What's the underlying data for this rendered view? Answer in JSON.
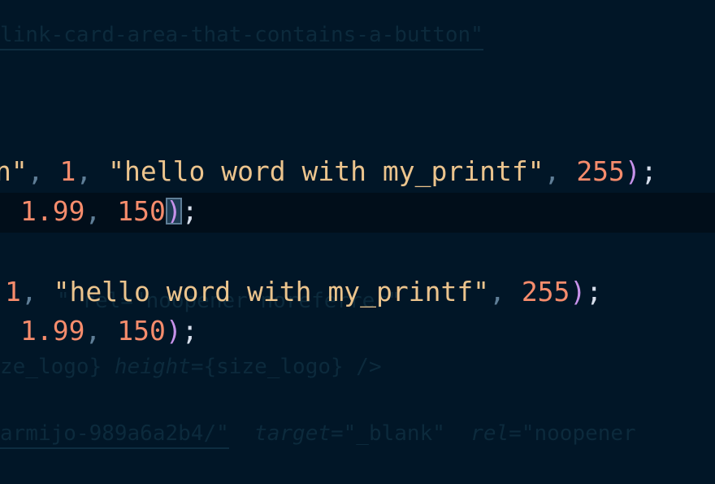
{
  "editor": {
    "ghost_lines": {
      "top": "link-card-area-that-contains-a-button\"",
      "mid": "\" rel=\"noopener noreferrer\"",
      "logo_a": "ze_logo}",
      "logo_b": "height",
      "logo_c": "={size_logo} />",
      "bottom_url": "armijo-989a6a2b4/\"",
      "bottom_target_attr": "target",
      "bottom_target_val": "=\"_blank\"",
      "bottom_rel_attr": "rel",
      "bottom_rel_val": "=\"noopener"
    },
    "lines": [
      {
        "q_open": "n\"",
        "comma1": ",",
        "num1": "1",
        "comma2": ",",
        "string": "\"hello word with my_printf\"",
        "comma3": ",",
        "num2": "255",
        "close_paren": ")",
        "semicolon": ";"
      },
      {
        "num1": "1.99",
        "comma1": ",",
        "num2": "150",
        "close_paren": ")",
        "semicolon": ";"
      },
      {
        "num1": "1",
        "comma1": ",",
        "string": "\"hello word with my_printf\"",
        "comma2": ",",
        "num2": "255",
        "close_paren": ")",
        "semicolon": ";"
      },
      {
        "num1": "1.99",
        "comma1": ",",
        "num2": "150",
        "close_paren": ")",
        "semicolon": ";"
      }
    ]
  },
  "colors": {
    "background": "#011627",
    "string": "#ecc48d",
    "number": "#f78c6c",
    "punctuation": "#5f7e97",
    "bracket": "#c792ea",
    "text": "#d6deeb"
  }
}
